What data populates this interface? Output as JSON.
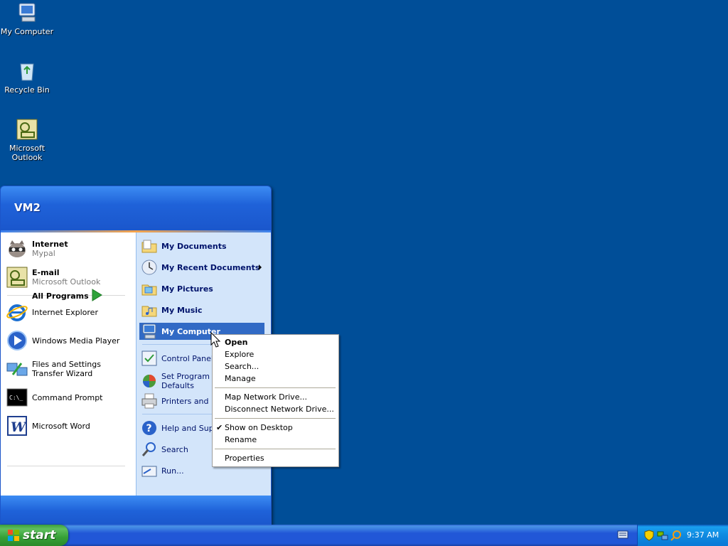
{
  "desktop": {
    "icons": [
      {
        "label": "My Computer",
        "icon": "my-computer-icon"
      },
      {
        "label": "Recycle Bin",
        "icon": "recycle-bin-icon"
      },
      {
        "label": "Microsoft Outlook",
        "icon": "outlook-icon"
      }
    ],
    "background_color": "#004e98"
  },
  "start_menu": {
    "user_name": "VM2",
    "pinned": [
      {
        "title": "Internet",
        "subtitle": "Mypal",
        "icon": "raccoon-browser-icon"
      },
      {
        "title": "E-mail",
        "subtitle": "Microsoft Outlook",
        "icon": "outlook-icon"
      }
    ],
    "recent": [
      {
        "label": "Internet Explorer",
        "icon": "internet-explorer-icon"
      },
      {
        "label": "Windows Media Player",
        "icon": "media-player-icon"
      },
      {
        "label": "Files and Settings Transfer Wizard",
        "icon": "transfer-wizard-icon"
      },
      {
        "label": "Command Prompt",
        "icon": "command-prompt-icon"
      },
      {
        "label": "Microsoft Word",
        "icon": "word-icon"
      }
    ],
    "all_programs": "All Programs",
    "right": [
      {
        "label": "My Documents",
        "icon": "folder-icon"
      },
      {
        "label": "My Recent Documents",
        "icon": "recent-documents-icon"
      },
      {
        "label": "My Pictures",
        "icon": "folder-icon"
      },
      {
        "label": "My Music",
        "icon": "folder-icon"
      },
      {
        "label": "My Computer",
        "icon": "my-computer-icon"
      },
      {
        "label": "Control Panel",
        "icon": "control-panel-icon"
      },
      {
        "label": "Set Program Ac",
        "label2": "Defaults",
        "icon": "program-defaults-icon"
      },
      {
        "label": "Printers and Fa",
        "icon": "printer-icon"
      },
      {
        "label": "Help and Suppo",
        "icon": "help-icon"
      },
      {
        "label": "Search",
        "icon": "search-icon"
      },
      {
        "label": "Run...",
        "icon": "run-icon"
      }
    ]
  },
  "context_menu": {
    "items": [
      "Open",
      "Explore",
      "Search...",
      "Manage",
      "Map Network Drive...",
      "Disconnect Network Drive...",
      "Show on Desktop",
      "Rename",
      "Properties"
    ],
    "checked": "Show on Desktop"
  },
  "taskbar": {
    "start_label": "start",
    "clock": "9:37 AM"
  }
}
